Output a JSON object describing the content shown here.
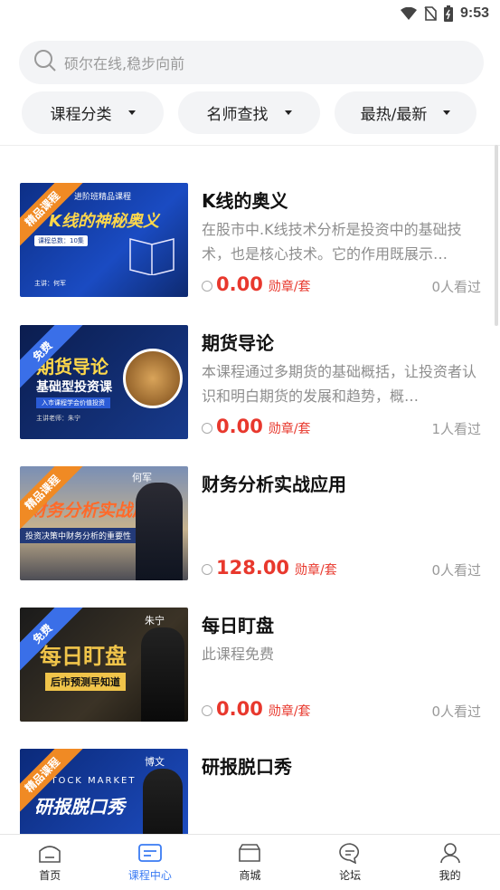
{
  "status": {
    "time": "9:53"
  },
  "search": {
    "placeholder": "硕尔在线,稳步向前"
  },
  "filters": [
    {
      "label": "课程分类"
    },
    {
      "label": "名师查找"
    },
    {
      "label": "最热/最新"
    }
  ],
  "courses": [
    {
      "title": "K线的奥义",
      "desc": "在股市中.K线技术分析是投资中的基础技术，也是核心技术。它的作用既展示…",
      "price": "0.00",
      "unit": "勋章/套",
      "views": "0人看过",
      "ribbon": "精品课程",
      "thumb_text": "K线的神秘奥义",
      "thumb_sub": "进阶班精品课程",
      "thumb_count": "课程总数：10集",
      "thumb_author": "主讲：何军"
    },
    {
      "title": "期货导论",
      "desc": "本课程通过多期货的基础概括，让投资者认识和明白期货的发展和趋势，概…",
      "price": "0.00",
      "unit": "勋章/套",
      "views": "1人看过",
      "ribbon": "免费",
      "thumb_text": "期货导论",
      "thumb_sub": "基础型投资课",
      "thumb_band": "入市课程学会价值投资",
      "thumb_author": "主讲老师：朱宁"
    },
    {
      "title": "财务分析实战应用",
      "desc": "",
      "price": "128.00",
      "unit": "勋章/套",
      "views": "0人看过",
      "ribbon": "精品课程",
      "thumb_text": "财务分析实战应用",
      "thumb_band": "投资决策中财务分析的重要性",
      "thumb_author": "何军"
    },
    {
      "title": "每日盯盘",
      "desc": "此课程免费",
      "price": "0.00",
      "unit": "勋章/套",
      "views": "0人看过",
      "ribbon": "免费",
      "thumb_text": "每日盯盘",
      "thumb_band": "后市预测早知道",
      "thumb_author": "朱宁"
    },
    {
      "title": "研报脱口秀",
      "desc": "",
      "price": "",
      "unit": "",
      "views": "",
      "ribbon": "精品课程",
      "thumb_text": "研报脱口秀",
      "thumb_sub": "STOCK MARKET",
      "thumb_author": "博文"
    }
  ],
  "tabs": [
    {
      "label": "首页"
    },
    {
      "label": "课程中心"
    },
    {
      "label": "商城"
    },
    {
      "label": "论坛"
    },
    {
      "label": "我的"
    }
  ],
  "colors": {
    "accent": "#3a7bf3",
    "price": "#e8382d",
    "ribbon_orange": "#f08a24",
    "ribbon_blue": "#3a6fe8"
  }
}
